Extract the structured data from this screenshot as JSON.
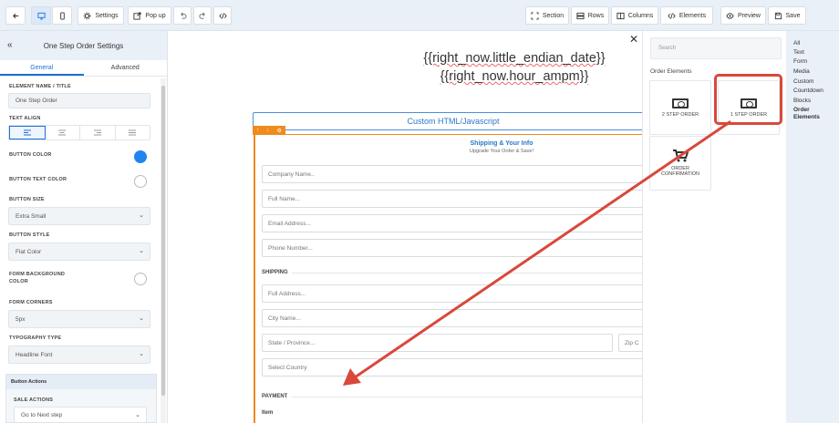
{
  "toolbar": {
    "settings": "Settings",
    "popup": "Pop up",
    "section": "Section",
    "rows": "Rows",
    "columns": "Columns",
    "elements": "Elements",
    "preview": "Preview",
    "save": "Save"
  },
  "left_panel": {
    "title": "One Step Order Settings",
    "tabs": [
      "General",
      "Advanced"
    ],
    "element_name_label": "ELEMENT NAME / TITLE",
    "element_name_value": "One Step Order",
    "text_align_label": "TEXT ALIGN",
    "button_color_label": "BUTTON COLOR",
    "button_text_color_label": "BUTTON TEXT COLOR",
    "button_size_label": "BUTTON SIZE",
    "button_size_value": "Extra Small",
    "button_style_label": "BUTTON STYLE",
    "button_style_value": "Flat Color",
    "form_bg_label_1": "FORM BACKGROUND",
    "form_bg_label_2": "COLOR",
    "form_corners_label": "FORM CORNERS",
    "form_corners_value": "5px",
    "typography_label": "TYPOGRAPHY TYPE",
    "typography_value": "Headline Font",
    "button_actions_label": "Button Actions",
    "sale_actions_label": "SALE ACTIONS",
    "sale_actions_value": "Go to Next step",
    "colors": {
      "button_color": "#2185f0",
      "accent": "#1f6fd6"
    }
  },
  "canvas": {
    "merge_line_1": "{{right_now.little_endian_date}}",
    "merge_line_2": "{{right_now.hour_ampm}}",
    "html_box_label": "Custom HTML/Javascript",
    "form_title": "Shipping & Your Info",
    "form_subtitle": "Upgrade Your Order & Save!",
    "company_placeholder": "Company Name..",
    "fullname_placeholder": "Full Name...",
    "email_placeholder": "Email Address...",
    "phone_placeholder": "Phone Number...",
    "shipping_label": "SHIPPING",
    "address_placeholder": "Full Address...",
    "city_placeholder": "City Name...",
    "state_placeholder": "State / Province...",
    "zip_placeholder": "Zip C",
    "country_placeholder": "Select Country",
    "payment_label": "PAYMENT",
    "item_label": "Item"
  },
  "elements_panel": {
    "search_placeholder": "Search",
    "section_label": "Order Elements",
    "tiles": [
      {
        "label": "2 STEP ORDER",
        "icon": "cash-icon"
      },
      {
        "label": "1 STEP ORDER",
        "icon": "cash-icon"
      },
      {
        "label": "ORDER CONFIRMATION",
        "icon": "cart-icon"
      }
    ]
  },
  "categories": [
    "All",
    "Text",
    "Form",
    "Media",
    "Custom",
    "Countdown",
    "Blocks",
    "Order Elements"
  ]
}
